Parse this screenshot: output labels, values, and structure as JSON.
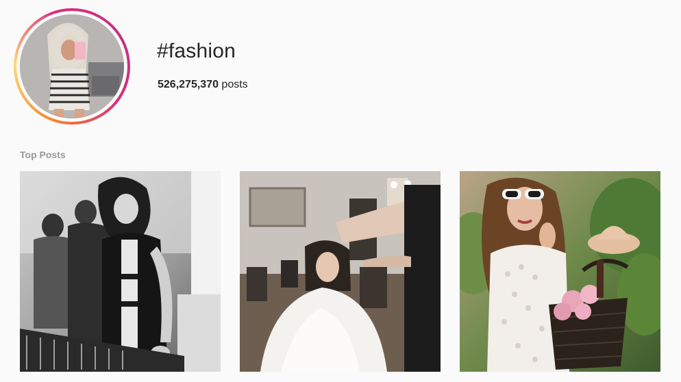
{
  "header": {
    "hashtag": "#fashion",
    "post_count": "526,275,370",
    "post_count_suffix": " posts",
    "avatar_icon": "profile-photo"
  },
  "top_posts": {
    "label": "Top Posts",
    "posts": [
      {
        "icon": "photo-bw-studio",
        "tone": "grayscale"
      },
      {
        "icon": "photo-hair-salon",
        "tone": "warm-gray"
      },
      {
        "icon": "photo-sunglasses-basket",
        "tone": "green-warm"
      }
    ]
  },
  "colors": {
    "background": "#fafafa",
    "text": "#262626",
    "muted": "#999999",
    "ring_gradient": [
      "#f58529",
      "#feda77",
      "#dd2a7b",
      "#c13584"
    ]
  }
}
